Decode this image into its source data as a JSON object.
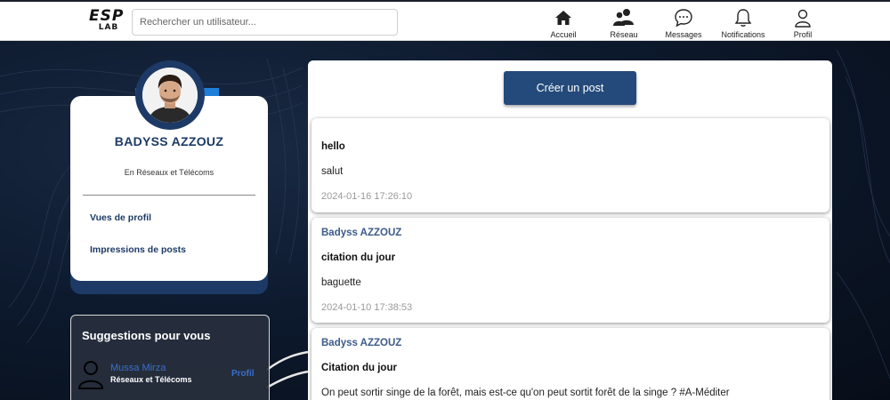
{
  "header": {
    "logo_top": "ESP",
    "logo_bottom": "LAB",
    "search_placeholder": "Rechercher un utilisateur...",
    "nav": [
      {
        "label": "Accueil",
        "icon": "home-icon"
      },
      {
        "label": "Réseau",
        "icon": "network-icon"
      },
      {
        "label": "Messages",
        "icon": "messages-icon"
      },
      {
        "label": "Notifications",
        "icon": "bell-icon"
      },
      {
        "label": "Profil",
        "icon": "user-icon"
      }
    ]
  },
  "profile": {
    "name": "BADYSS AZZOUZ",
    "field": "En Réseaux et Télécoms",
    "links": [
      "Vues de profil",
      "Impressions de posts"
    ]
  },
  "suggestions": {
    "title": "Suggestions pour vous",
    "items": [
      {
        "name": "Mussa Mirza",
        "field": "Réseaux et Télécoms",
        "link": "Profil"
      }
    ]
  },
  "feed": {
    "create_label": "Créer un post",
    "posts": [
      {
        "author": "",
        "title": "hello",
        "body": "salut",
        "date": "2024-01-16 17:26:10"
      },
      {
        "author": "Badyss AZZOUZ",
        "title": "citation du jour",
        "body": "baguette",
        "date": "2024-01-10 17:38:53"
      },
      {
        "author": "Badyss AZZOUZ",
        "title": "Citation du jour",
        "body": "On peut sortir singe de la forêt, mais est-ce qu'on peut sortit forêt de la singe ? #A-Méditer",
        "date": ""
      }
    ]
  },
  "colors": {
    "primary": "#1d3a66",
    "button": "#234a7a",
    "accent_tab": "#1e7fd8",
    "link": "#3a6fc8"
  }
}
